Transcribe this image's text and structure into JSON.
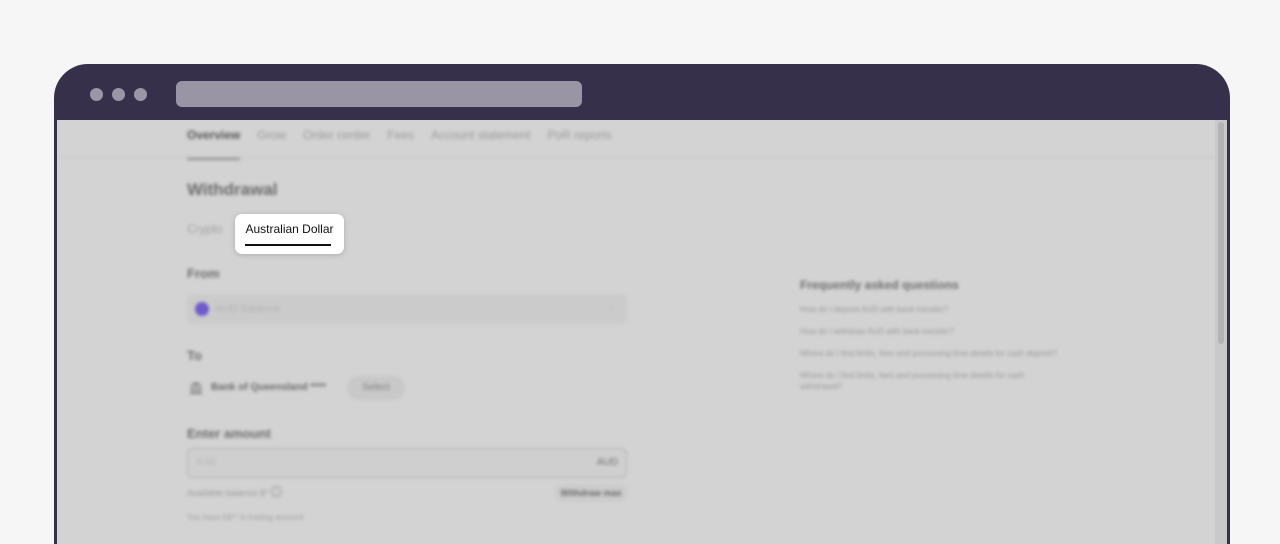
{
  "browser": {
    "url": ""
  },
  "nav": {
    "tabs": [
      "Overview",
      "Grow",
      "Order center",
      "Fees",
      "Account statement",
      "PoR reports"
    ],
    "active": "Overview"
  },
  "withdrawal": {
    "title": "Withdrawal",
    "tabs": {
      "crypto": "Crypto",
      "aud": "Australian Dollar"
    },
    "from": {
      "label": "From",
      "value": "AUD balance",
      "chevron": "⌄"
    },
    "to": {
      "label": "To",
      "bank_icon": "bank-icon",
      "bank_name": "Bank of Queensland ****",
      "select_label": "Select"
    },
    "amount": {
      "label": "Enter amount",
      "placeholder": "0.00",
      "currency": "AUD",
      "available_balance": "Available balance $*",
      "info_icon": "i",
      "withdraw_max": "Withdraw max",
      "trading_note": "You have A$** in trading account"
    }
  },
  "faq": {
    "title": "Frequently asked questions",
    "items": [
      "How do I deposit AUD with bank transfer?",
      "How do I withdraw AUD with bank transfer?",
      "Where do I find limits, fees and processing time details for cash deposit?",
      "Where do I find limits, fees and processing time details for cash withdrawal?"
    ]
  }
}
